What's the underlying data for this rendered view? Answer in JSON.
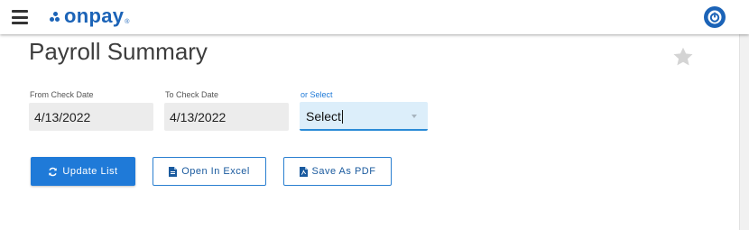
{
  "header": {
    "logo_text": "onpay",
    "logo_mark": "®",
    "menu_icon": "hamburger-icon",
    "power_icon": "power-icon",
    "brand_color": "#1b63b7"
  },
  "page": {
    "title": "Payroll Summary",
    "favorite_icon": "star-icon"
  },
  "filters": {
    "from_label": "From Check Date",
    "from_value": "4/13/2022",
    "to_label": "To Check Date",
    "to_value": "4/13/2022",
    "or_select_label": "or Select",
    "select_value": "Select"
  },
  "buttons": {
    "update_label": "Update List",
    "update_icon": "refresh-icon",
    "excel_label": "Open In Excel",
    "excel_icon": "file-icon",
    "pdf_label": "Save As PDF",
    "pdf_icon": "pdf-file-icon",
    "primary_color": "#1f7ad8"
  }
}
